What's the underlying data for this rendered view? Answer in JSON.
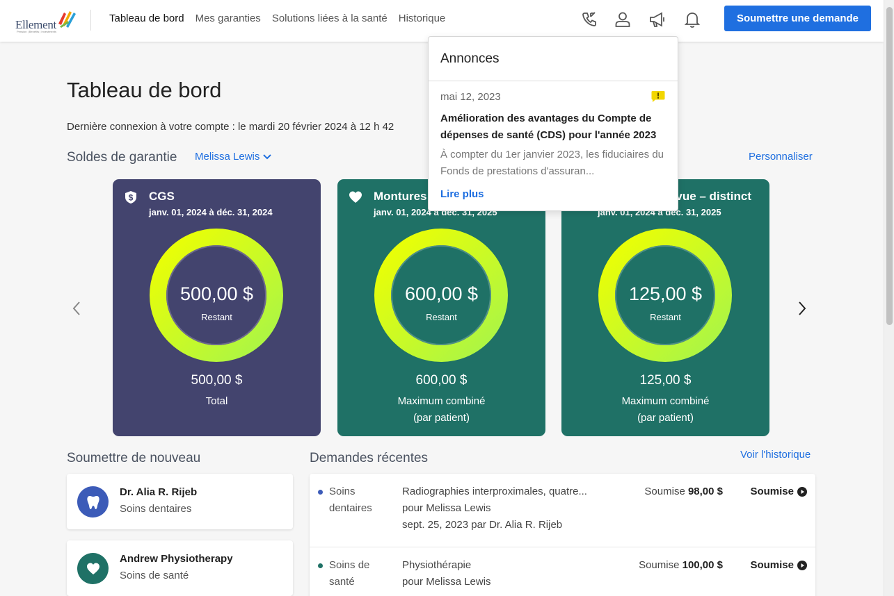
{
  "header": {
    "logo_text": "Ellement",
    "logo_sub": "Pension | Benefits | Investments",
    "nav": [
      "Tableau de bord",
      "Mes garanties",
      "Solutions liées à la santé",
      "Historique"
    ],
    "submit_label": "Soumettre une demande"
  },
  "page": {
    "title": "Tableau de bord",
    "last_login": "Dernière connexion à votre compte : le mardi 20 février 2024 à 12 h 42"
  },
  "balances": {
    "title": "Soldes de garantie",
    "member": "Melissa Lewis",
    "customize": "Personnaliser",
    "cards": [
      {
        "title": "CGS",
        "dates": "janv. 01, 2024 à déc. 31, 2024",
        "amount": "500,00 $",
        "remaining": "Restant",
        "total": "500,00 $",
        "label1": "Total",
        "label2": "",
        "color": "#43446e",
        "icon": "shield-dollar-icon"
      },
      {
        "title": "Montures",
        "dates": "janv. 01, 2024 à déc. 31, 2025",
        "amount": "600,00 $",
        "remaining": "Restant",
        "total": "600,00 $",
        "label1": "Maximum combiné",
        "label2": "(par patient)",
        "color": "#1f7166",
        "icon": "heart-icon"
      },
      {
        "title": "vue – distinct",
        "dates": "janv. 01, 2024 à déc. 31, 2025",
        "amount": "125,00 $",
        "remaining": "Restant",
        "total": "125,00 $",
        "label1": "Maximum combiné",
        "label2": "(par patient)",
        "color": "#1f7166",
        "icon": "heart-icon"
      }
    ]
  },
  "announcements": {
    "title": "Annonces",
    "date": "mai 12, 2023",
    "headline": "Amélioration des avantages du Compte de dépenses de santé (CDS) pour l'année 2023",
    "body": "À compter du 1er janvier 2023, les fiduciaires du Fonds de prestations d'assuran...",
    "read_more": "Lire plus",
    "badge_color": "#f2d600"
  },
  "resubmit": {
    "title": "Soumettre de nouveau",
    "items": [
      {
        "name": "Dr. Alia R. Rijeb",
        "type": "Soins dentaires",
        "color": "#3c5bb8",
        "icon": "tooth-icon"
      },
      {
        "name": "Andrew Physiotherapy",
        "type": "Soins de santé",
        "color": "#1f7166",
        "icon": "heart-icon"
      }
    ]
  },
  "recent": {
    "title": "Demandes récentes",
    "history_link": "Voir l'historique",
    "claims": [
      {
        "cat1": "Soins",
        "cat2": "dentaires",
        "desc1": "Radiographies interproximales, quatre...",
        "desc2": "pour Melissa Lewis",
        "desc3": "sept. 25, 2023 par Dr. Alia R. Rijeb",
        "amount_prefix": "Soumise ",
        "amount": "98,00 $",
        "status": "Soumise",
        "dot_color": "#3c5bb8"
      },
      {
        "cat1": "Soins de",
        "cat2": "santé",
        "desc1": "Physiothérapie",
        "desc2": "pour Melissa Lewis",
        "desc3": "",
        "amount_prefix": "Soumise ",
        "amount": "100,00 $",
        "status": "Soumise",
        "dot_color": "#1f7166"
      }
    ]
  }
}
